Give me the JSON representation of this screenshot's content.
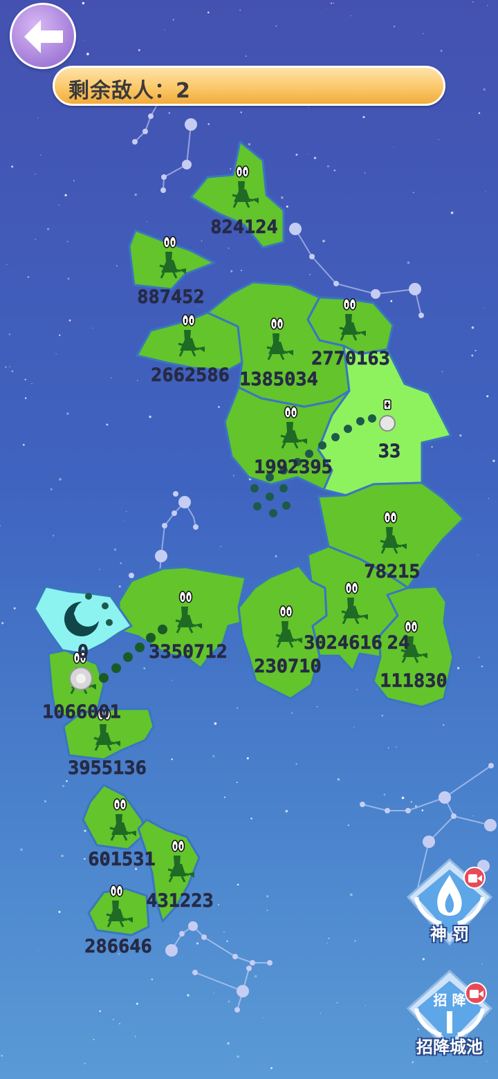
{
  "header": {
    "enemy_label": "剩余敌人：",
    "enemy_count": "2"
  },
  "regions": [
    {
      "id": "r1",
      "value": "824124",
      "color": "#63c42c"
    },
    {
      "id": "r2",
      "value": "887452",
      "color": "#63c42c"
    },
    {
      "id": "r3",
      "value": "2662586",
      "color": "#63c42c"
    },
    {
      "id": "r4",
      "value": "1385034",
      "color": "#63c42c"
    },
    {
      "id": "r5",
      "value": "2770163",
      "color": "#63c42c"
    },
    {
      "id": "r6",
      "value": "33",
      "color": "#8ef25e",
      "owner": "ally"
    },
    {
      "id": "r7",
      "value": "1992395",
      "color": "#63c42c"
    },
    {
      "id": "r8",
      "value": "78215",
      "color": "#63c42c"
    },
    {
      "id": "r9",
      "value": "0",
      "color": "#8cf3f0",
      "owner": "player"
    },
    {
      "id": "r10",
      "value": "3350712",
      "color": "#63c42c"
    },
    {
      "id": "r11",
      "value": "230710",
      "color": "#63c42c"
    },
    {
      "id": "r12",
      "value": "3024616",
      "color": "#63c42c"
    },
    {
      "id": "r13",
      "value": "24",
      "color": "#63c42c"
    },
    {
      "id": "r14",
      "value": "111830",
      "color": "#63c42c"
    },
    {
      "id": "r15",
      "value": "1066001",
      "color": "#63c42c"
    },
    {
      "id": "r16",
      "value": "3955136",
      "color": "#63c42c"
    },
    {
      "id": "r17",
      "value": "601531",
      "color": "#63c42c"
    },
    {
      "id": "r18",
      "value": "431223",
      "color": "#63c42c"
    },
    {
      "id": "r19",
      "value": "286646",
      "color": "#63c42c"
    }
  ],
  "buttons": {
    "divine_punish": "神 罚",
    "divine_punish_icon": "flame-icon",
    "surrender_city": "招降城池",
    "surrender_emblem": "招 降",
    "surrender_icon": "flag-icon",
    "video_icon": "video-ad-icon"
  },
  "colors": {
    "enemy_land": "#63c42c",
    "ally_land": "#8ef25e",
    "player_land": "#8cf3f0",
    "unit_dark": "#1d5a4a",
    "label_text": "#262a44"
  }
}
